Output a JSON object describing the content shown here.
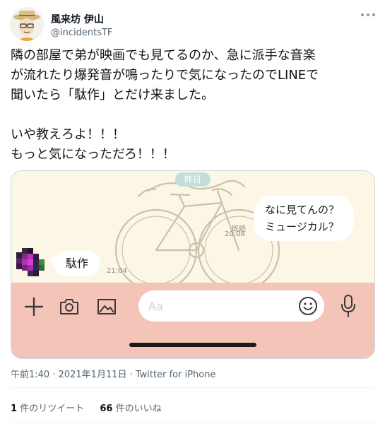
{
  "user": {
    "display_name": "風来坊 伊山",
    "handle": "@incidentsTF"
  },
  "tweet": {
    "lines": [
      "隣の部屋で弟が映画でも見てるのか、急に派手な音楽",
      "が流れたり爆発音が鳴ったりで気になったのでLINEで",
      "聞いたら「駄作」とだけ来ました。",
      "",
      "いや教えろよ！！！",
      "もっと気になっただろ！！！"
    ]
  },
  "chat": {
    "date_chip": "昨日",
    "sent_message": {
      "lines": [
        "なに見てんの？",
        "ミュージカル？"
      ],
      "read_label": "既読",
      "time": "20:08"
    },
    "received_message": {
      "text": "駄作",
      "time": "21:04"
    },
    "input_placeholder": "Aa",
    "colors": {
      "chat_background": "#fbf6e6",
      "toolbar_background": "#f5c4b8",
      "date_chip": "#c4dfd9"
    }
  },
  "meta": {
    "timestamp": "午前1:40 · 2021年1月11日 · Twitter for iPhone"
  },
  "stats": {
    "retweets_count": "1",
    "retweets_label": "件のリツイート",
    "likes_count": "66",
    "likes_label": "件のいいね"
  },
  "icons": {
    "more": "more-horizontal-icon",
    "plus": "plus-icon",
    "camera": "camera-icon",
    "image": "image-icon",
    "emoji": "emoji-icon",
    "mic": "microphone-icon"
  }
}
